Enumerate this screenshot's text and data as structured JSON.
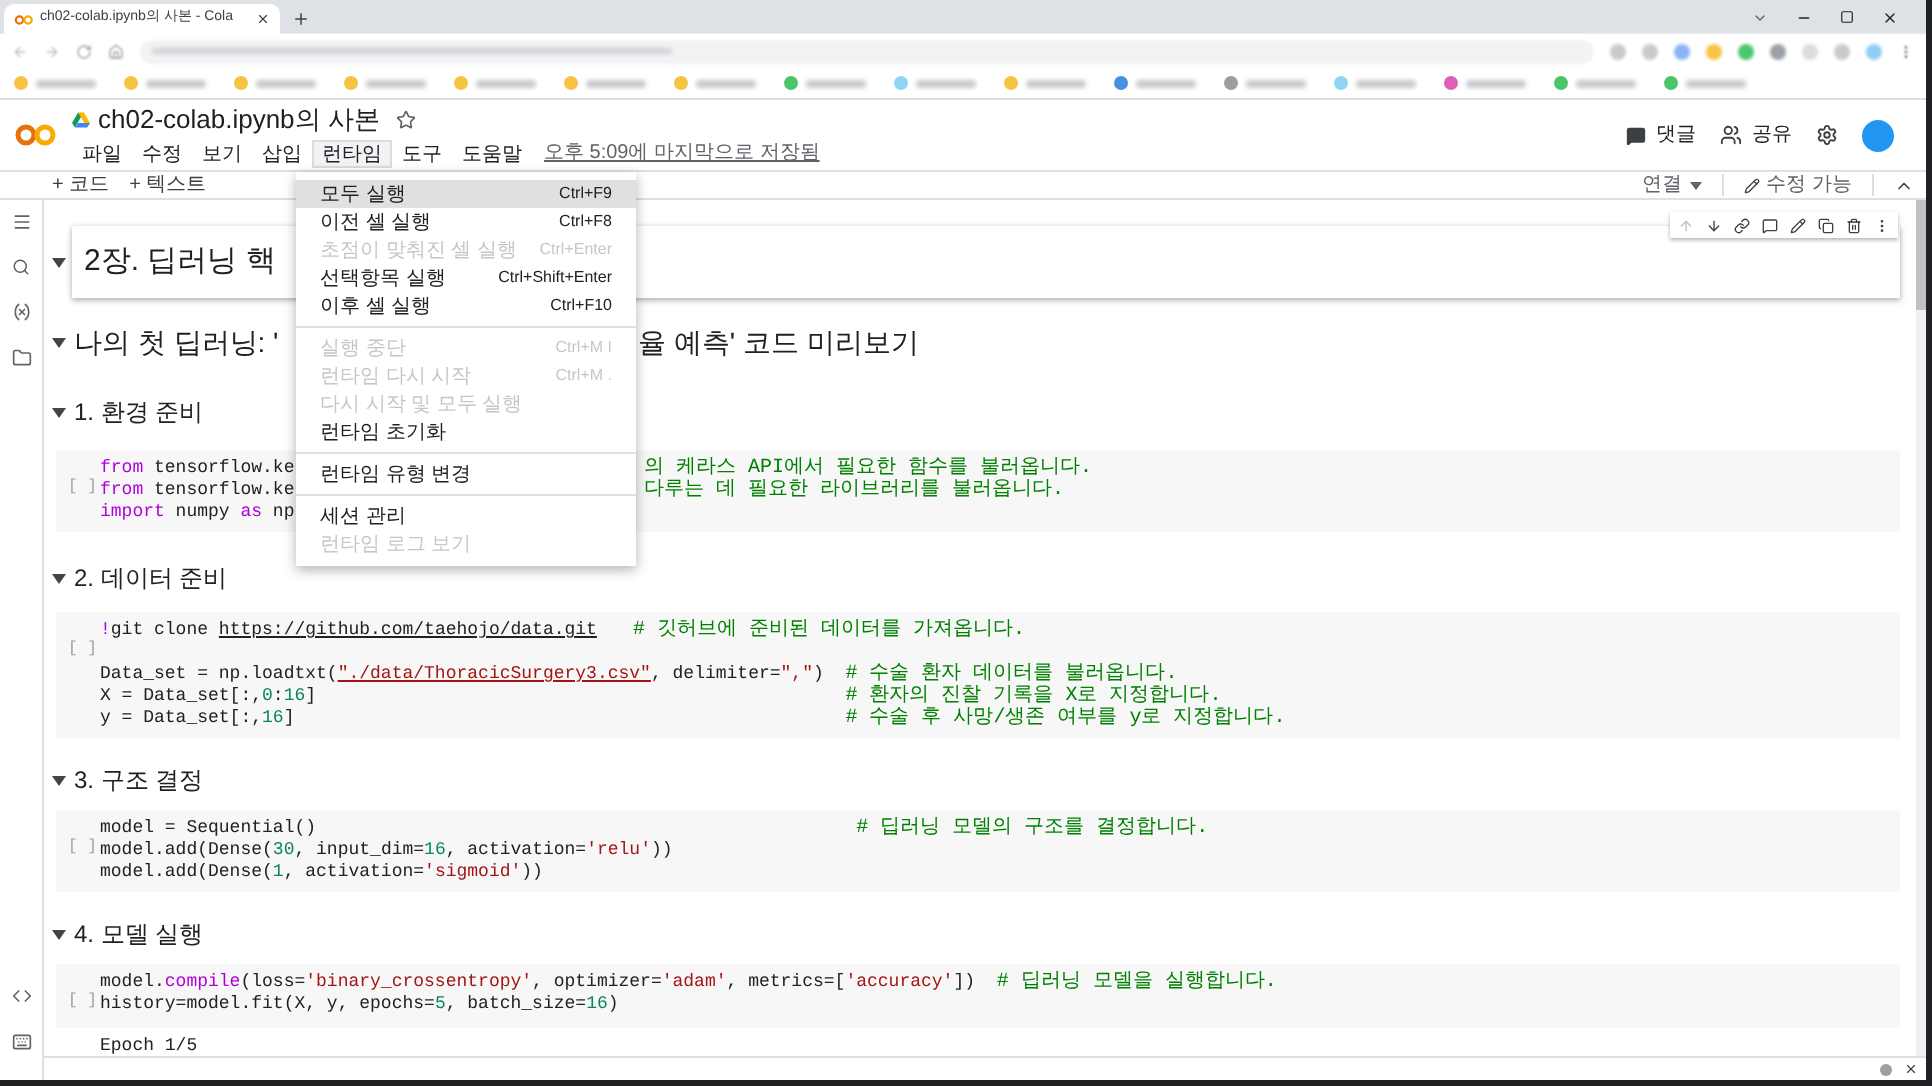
{
  "browser": {
    "tab_title": "ch02-colab.ipynb의 사본 - Cola",
    "bookmarks": [
      {
        "color": "#f6c343"
      },
      {
        "color": "#f6c343"
      },
      {
        "color": "#f6c343"
      },
      {
        "color": "#f6c343"
      },
      {
        "color": "#f6c343"
      },
      {
        "color": "#f6c343"
      },
      {
        "color": "#f6c343"
      },
      {
        "color": "#4cc66b"
      },
      {
        "color": "#8fd3f5"
      },
      {
        "color": "#f6c343"
      },
      {
        "color": "#4a90e2"
      },
      {
        "color": "#9e9e9e"
      },
      {
        "color": "#8fd3f5"
      },
      {
        "color": "#e05fb8"
      },
      {
        "color": "#4cc66b"
      },
      {
        "color": "#4cc66b"
      }
    ]
  },
  "notebook": {
    "title": "ch02-colab.ipynb의 사본",
    "starred": false
  },
  "menubar": [
    {
      "label": "파일",
      "selected": false
    },
    {
      "label": "수정",
      "selected": false
    },
    {
      "label": "보기",
      "selected": false
    },
    {
      "label": "삽입",
      "selected": false
    },
    {
      "label": "런타임",
      "selected": true
    },
    {
      "label": "도구",
      "selected": false
    },
    {
      "label": "도움말",
      "selected": false
    }
  ],
  "last_saved": "오후 5:09에 마지막으로 저장됨",
  "header_actions": {
    "comment": "댓글",
    "share": "공유"
  },
  "toolbar": {
    "add_code": "+ 코드",
    "add_text": "+ 텍스트",
    "connect": "연결",
    "editable": "수정 가능"
  },
  "runtime_menu": [
    {
      "kind": "item",
      "label": "모두 실행",
      "shortcut": "Ctrl+F9",
      "selected": true,
      "disabled": false
    },
    {
      "kind": "item",
      "label": "이전 셀 실행",
      "shortcut": "Ctrl+F8",
      "selected": false,
      "disabled": false
    },
    {
      "kind": "item",
      "label": "초점이 맞춰진 셀 실행",
      "shortcut": "Ctrl+Enter",
      "selected": false,
      "disabled": true
    },
    {
      "kind": "item",
      "label": "선택항목 실행",
      "shortcut": "Ctrl+Shift+Enter",
      "selected": false,
      "disabled": false
    },
    {
      "kind": "item",
      "label": "이후 셀 실행",
      "shortcut": "Ctrl+F10",
      "selected": false,
      "disabled": false
    },
    {
      "kind": "divider"
    },
    {
      "kind": "item",
      "label": "실행 중단",
      "shortcut": "Ctrl+M I",
      "selected": false,
      "disabled": true
    },
    {
      "kind": "item",
      "label": "런타임 다시 시작",
      "shortcut": "Ctrl+M .",
      "selected": false,
      "disabled": true
    },
    {
      "kind": "item",
      "label": "다시 시작 및 모두 실행",
      "selected": false,
      "disabled": true
    },
    {
      "kind": "item",
      "label": "런타임 초기화",
      "selected": false,
      "disabled": false
    },
    {
      "kind": "divider"
    },
    {
      "kind": "item",
      "label": "런타임 유형 변경",
      "selected": false,
      "disabled": false
    },
    {
      "kind": "divider"
    },
    {
      "kind": "item",
      "label": "세션 관리",
      "selected": false,
      "disabled": false
    },
    {
      "kind": "item",
      "label": "런타임 로그 보기",
      "selected": false,
      "disabled": true
    }
  ],
  "cells": [
    {
      "kind": "title",
      "text": "2장. 딥러닝 핵"
    },
    {
      "kind": "heading_large",
      "text": "나의 첫 딥러닝: '",
      "text_after_menu": "율 예측' 코드 미리보기"
    },
    {
      "kind": "heading",
      "text": "1. 환경 준비"
    },
    {
      "kind": "code",
      "prompt": "[ ]",
      "lines": [
        {
          "kind": "code",
          "segments": [
            {
              "kind": "keyword",
              "text": "from"
            },
            {
              "kind": "plain",
              "text": " tensorflow.ke"
            }
          ],
          "after_menu": [
            {
              "kind": "comment",
              "text": "의 케라스 API에서 필요한 함수를 불러옵니다."
            }
          ]
        },
        {
          "kind": "code",
          "segments": [
            {
              "kind": "keyword",
              "text": "from"
            },
            {
              "kind": "plain",
              "text": " tensorflow.ke"
            }
          ],
          "after_menu": [
            {
              "kind": "comment",
              "text": "다루는 데 필요한 라이브러리를 불러옵니다."
            }
          ]
        },
        {
          "kind": "code",
          "segments": [
            {
              "kind": "keyword",
              "text": "import"
            },
            {
              "kind": "plain",
              "text": " numpy "
            },
            {
              "kind": "keyword",
              "text": "as"
            },
            {
              "kind": "plain",
              "text": " np"
            }
          ]
        }
      ]
    },
    {
      "kind": "heading",
      "text": "2. 데이터 준비"
    },
    {
      "kind": "code",
      "prompt": "[ ]",
      "lines": [
        {
          "kind": "code",
          "segments": [
            {
              "kind": "keyword",
              "text": "!"
            },
            {
              "kind": "plain",
              "text": "git clone "
            },
            {
              "kind": "link",
              "text": "https://github.com/taehojo/data.git"
            },
            {
              "kind": "comment",
              "text": "   # 깃허브에 준비된 데이터를 가져옵니다."
            }
          ]
        },
        {
          "kind": "blank"
        },
        {
          "kind": "code",
          "segments": [
            {
              "kind": "plain",
              "text": "Data_set = np.loadtxt("
            },
            {
              "kind": "string_link",
              "text": "\"./data/ThoracicSurgery3.csv\""
            },
            {
              "kind": "plain",
              "text": ", delimiter="
            },
            {
              "kind": "string",
              "text": "\",\""
            },
            {
              "kind": "plain",
              "text": ")  "
            },
            {
              "kind": "comment",
              "text": "# 수술 환자 데이터를 불러옵니다."
            }
          ]
        },
        {
          "kind": "code",
          "segments": [
            {
              "kind": "plain",
              "text": "X = Data_set[:,"
            },
            {
              "kind": "number",
              "text": "0"
            },
            {
              "kind": "plain",
              "text": ":"
            },
            {
              "kind": "number",
              "text": "16"
            },
            {
              "kind": "plain",
              "text": "]                                                 "
            },
            {
              "kind": "comment",
              "text": "# 환자의 진찰 기록을 X로 지정합니다."
            }
          ]
        },
        {
          "kind": "code",
          "segments": [
            {
              "kind": "plain",
              "text": "y = Data_set[:,"
            },
            {
              "kind": "number",
              "text": "16"
            },
            {
              "kind": "plain",
              "text": "]                                                   "
            },
            {
              "kind": "comment",
              "text": "# 수술 후 사망/생존 여부를 y로 지정합니다."
            }
          ]
        }
      ]
    },
    {
      "kind": "heading",
      "text": "3. 구조 결정"
    },
    {
      "kind": "code",
      "prompt": "[ ]",
      "lines": [
        {
          "kind": "code",
          "segments": [
            {
              "kind": "plain",
              "text": "model = Sequential()                                                  "
            },
            {
              "kind": "comment",
              "text": "# 딥러닝 모델의 구조를 결정합니다."
            }
          ]
        },
        {
          "kind": "code",
          "segments": [
            {
              "kind": "plain",
              "text": "model.add(Dense("
            },
            {
              "kind": "number",
              "text": "30"
            },
            {
              "kind": "plain",
              "text": ", input_dim="
            },
            {
              "kind": "number",
              "text": "16"
            },
            {
              "kind": "plain",
              "text": ", activation="
            },
            {
              "kind": "string",
              "text": "'relu'"
            },
            {
              "kind": "plain",
              "text": "))"
            }
          ]
        },
        {
          "kind": "code",
          "segments": [
            {
              "kind": "plain",
              "text": "model.add(Dense("
            },
            {
              "kind": "number",
              "text": "1"
            },
            {
              "kind": "plain",
              "text": ", activation="
            },
            {
              "kind": "string",
              "text": "'sigmoid'"
            },
            {
              "kind": "plain",
              "text": "))"
            }
          ]
        }
      ]
    },
    {
      "kind": "heading",
      "text": "4. 모델 실행"
    },
    {
      "kind": "code",
      "prompt": "[ ]",
      "lines": [
        {
          "kind": "code",
          "segments": [
            {
              "kind": "plain",
              "text": "model."
            },
            {
              "kind": "keyword",
              "text": "compile"
            },
            {
              "kind": "plain",
              "text": "(loss="
            },
            {
              "kind": "string",
              "text": "'binary_crossentropy'"
            },
            {
              "kind": "plain",
              "text": ", optimizer="
            },
            {
              "kind": "string",
              "text": "'adam'"
            },
            {
              "kind": "plain",
              "text": ", metrics=["
            },
            {
              "kind": "string",
              "text": "'accuracy'"
            },
            {
              "kind": "plain",
              "text": "])  "
            },
            {
              "kind": "comment",
              "text": "# 딥러닝 모델을 실행합니다."
            }
          ]
        },
        {
          "kind": "code",
          "segments": [
            {
              "kind": "plain",
              "text": "history=model.fit(X, y, epochs="
            },
            {
              "kind": "number",
              "text": "5"
            },
            {
              "kind": "plain",
              "text": ", batch_size="
            },
            {
              "kind": "number",
              "text": "16"
            },
            {
              "kind": "plain",
              "text": ")"
            }
          ]
        }
      ]
    },
    {
      "kind": "output",
      "lines": [
        "Epoch 1/5"
      ]
    }
  ]
}
